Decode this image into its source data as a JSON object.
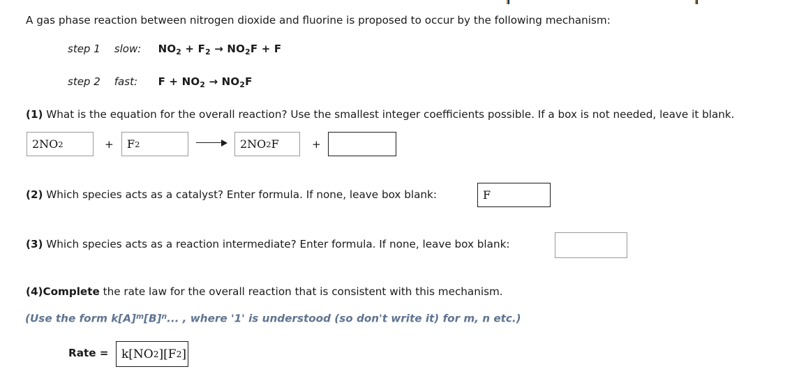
{
  "problem": {
    "intro": "A gas phase reaction between nitrogen dioxide and fluorine is proposed to occur by the following mechanism:",
    "steps": [
      {
        "label": "step 1",
        "speed": "slow:",
        "equation_html": "NO<sub>2</sub> + F<sub>2</sub> → NO<sub>2</sub>F + F"
      },
      {
        "label": "step 2",
        "speed": "fast:",
        "equation_html": "F + NO<sub>2</sub> → NO<sub>2</sub>F"
      }
    ]
  },
  "questions": {
    "q1": {
      "number": "(1)",
      "text": " What is the equation for the overall reaction? Use the smallest integer coefficients possible. If a box is not needed, leave it blank.",
      "operators": {
        "plus1": "+",
        "plus2": "+",
        "arrow": "arrow-right-icon"
      },
      "boxes": [
        {
          "name": "reactant-1",
          "value_html": "2NO<sub>2</sub>",
          "filled": true,
          "border": "light"
        },
        {
          "name": "reactant-2",
          "value_html": "F<sub>2</sub>",
          "filled": true,
          "border": "light"
        },
        {
          "name": "product-1",
          "value_html": "2NO<sub>2</sub>F",
          "filled": true,
          "border": "light"
        },
        {
          "name": "product-2",
          "value_html": "",
          "filled": false,
          "border": "dark"
        }
      ]
    },
    "q2": {
      "number": "(2)",
      "text": " Which species acts as a catalyst? Enter formula. If none, leave box blank:",
      "answer_html": "F",
      "border": "dark"
    },
    "q3": {
      "number": "(3)",
      "text": " Which species acts as a reaction intermediate? Enter formula. If none, leave box blank:",
      "answer_html": "",
      "border": "light"
    },
    "q4": {
      "number": "(4)",
      "bold_word": "Complete",
      "text": " the rate law for the overall reaction that is consistent with this mechanism.",
      "hint_html": "(Use the form k[A]<sup>m</sup>[B]<sup>n</sup>... , where '1' is understood (so don't write it) for m, n etc.)",
      "rate_label": "Rate =",
      "rate_value_html": "k[NO<sub>2</sub>][F<sub>2</sub>]",
      "border": "dark"
    }
  },
  "colors": {
    "text": "#1a1a1a",
    "hint": "#5f7490",
    "box_border_light": "#9a9a9a",
    "box_border_dark": "#1b1b1b",
    "background": "#ffffff"
  }
}
